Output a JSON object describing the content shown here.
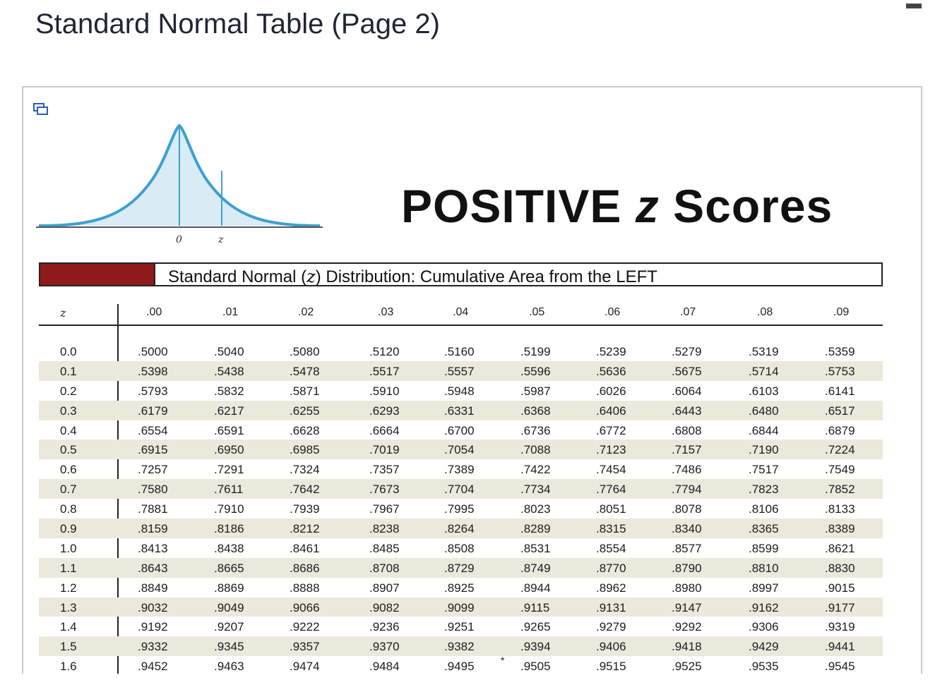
{
  "page": {
    "title": "Standard Normal Table (Page 2)"
  },
  "chart": {
    "label_zero": "0",
    "label_z": "z"
  },
  "heading": {
    "prefix": "POSITIVE ",
    "z": "z",
    "suffix": " Scores"
  },
  "banner": {
    "prefix": "Standard Normal (",
    "z": "z",
    "suffix": ") Distribution: Cumulative Area from the LEFT"
  },
  "table": {
    "z_header": "z",
    "columns": [
      ".00",
      ".01",
      ".02",
      ".03",
      ".04",
      ".05",
      ".06",
      ".07",
      ".08",
      ".09"
    ],
    "rows": [
      {
        "z": "0.0",
        "v": [
          ".5000",
          ".5040",
          ".5080",
          ".5120",
          ".5160",
          ".5199",
          ".5239",
          ".5279",
          ".5319",
          ".5359"
        ]
      },
      {
        "z": "0.1",
        "v": [
          ".5398",
          ".5438",
          ".5478",
          ".5517",
          ".5557",
          ".5596",
          ".5636",
          ".5675",
          ".5714",
          ".5753"
        ]
      },
      {
        "z": "0.2",
        "v": [
          ".5793",
          ".5832",
          ".5871",
          ".5910",
          ".5948",
          ".5987",
          ".6026",
          ".6064",
          ".6103",
          ".6141"
        ]
      },
      {
        "z": "0.3",
        "v": [
          ".6179",
          ".6217",
          ".6255",
          ".6293",
          ".6331",
          ".6368",
          ".6406",
          ".6443",
          ".6480",
          ".6517"
        ]
      },
      {
        "z": "0.4",
        "v": [
          ".6554",
          ".6591",
          ".6628",
          ".6664",
          ".6700",
          ".6736",
          ".6772",
          ".6808",
          ".6844",
          ".6879"
        ]
      },
      {
        "z": "0.5",
        "v": [
          ".6915",
          ".6950",
          ".6985",
          ".7019",
          ".7054",
          ".7088",
          ".7123",
          ".7157",
          ".7190",
          ".7224"
        ]
      },
      {
        "z": "0.6",
        "v": [
          ".7257",
          ".7291",
          ".7324",
          ".7357",
          ".7389",
          ".7422",
          ".7454",
          ".7486",
          ".7517",
          ".7549"
        ]
      },
      {
        "z": "0.7",
        "v": [
          ".7580",
          ".7611",
          ".7642",
          ".7673",
          ".7704",
          ".7734",
          ".7764",
          ".7794",
          ".7823",
          ".7852"
        ]
      },
      {
        "z": "0.8",
        "v": [
          ".7881",
          ".7910",
          ".7939",
          ".7967",
          ".7995",
          ".8023",
          ".8051",
          ".8078",
          ".8106",
          ".8133"
        ]
      },
      {
        "z": "0.9",
        "v": [
          ".8159",
          ".8186",
          ".8212",
          ".8238",
          ".8264",
          ".8289",
          ".8315",
          ".8340",
          ".8365",
          ".8389"
        ]
      },
      {
        "z": "1.0",
        "v": [
          ".8413",
          ".8438",
          ".8461",
          ".8485",
          ".8508",
          ".8531",
          ".8554",
          ".8577",
          ".8599",
          ".8621"
        ]
      },
      {
        "z": "1.1",
        "v": [
          ".8643",
          ".8665",
          ".8686",
          ".8708",
          ".8729",
          ".8749",
          ".8770",
          ".8790",
          ".8810",
          ".8830"
        ]
      },
      {
        "z": "1.2",
        "v": [
          ".8849",
          ".8869",
          ".8888",
          ".8907",
          ".8925",
          ".8944",
          ".8962",
          ".8980",
          ".8997",
          ".9015"
        ]
      },
      {
        "z": "1.3",
        "v": [
          ".9032",
          ".9049",
          ".9066",
          ".9082",
          ".9099",
          ".9115",
          ".9131",
          ".9147",
          ".9162",
          ".9177"
        ]
      },
      {
        "z": "1.4",
        "v": [
          ".9192",
          ".9207",
          ".9222",
          ".9236",
          ".9251",
          ".9265",
          ".9279",
          ".9292",
          ".9306",
          ".9319"
        ]
      },
      {
        "z": "1.5",
        "v": [
          ".9332",
          ".9345",
          ".9357",
          ".9370",
          ".9382",
          ".9394",
          ".9406",
          ".9418",
          ".9429",
          ".9441"
        ]
      },
      {
        "z": "1.6",
        "v": [
          ".9452",
          ".9463",
          ".9474",
          ".9484",
          ".9495",
          ".9505",
          ".9515",
          ".9525",
          ".9535",
          ".9545"
        ]
      }
    ],
    "star": "*"
  }
}
